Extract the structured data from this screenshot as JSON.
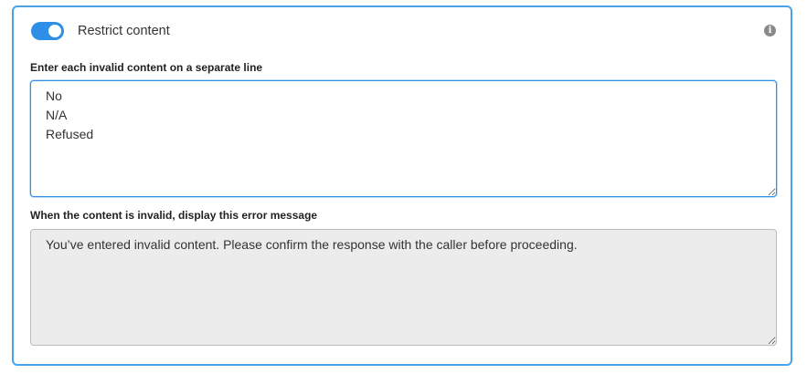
{
  "restrict": {
    "toggle_on": true,
    "label": "Restrict content",
    "info_icon": "info-icon"
  },
  "invalid_list": {
    "label": "Enter each invalid content on a separate line",
    "value": "No\nN/A\nRefused"
  },
  "error_message": {
    "label": "When the content is invalid, display this error message",
    "value": "You’ve entered invalid content. Please confirm the response with the caller before proceeding."
  },
  "colors": {
    "accent": "#2f8fe6",
    "panel_border": "#4aa3e8",
    "disabled_bg": "#ececec"
  }
}
